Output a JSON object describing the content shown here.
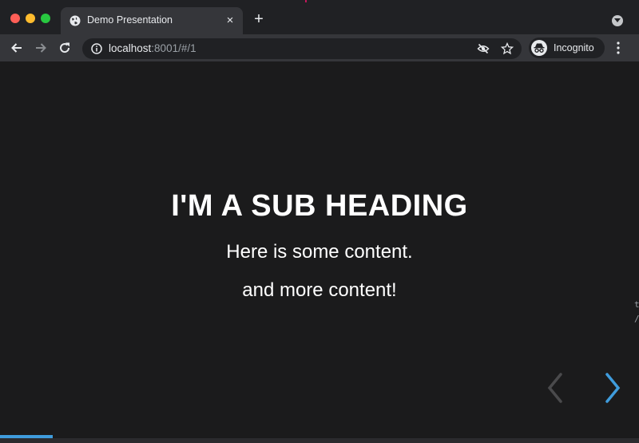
{
  "browser": {
    "tab": {
      "title": "Demo Presentation",
      "close_glyph": "×",
      "favicon": "globe-icon"
    },
    "new_tab_glyph": "+",
    "address_bar": {
      "host": "localhost",
      "rest": ":8001/#/1"
    },
    "profile": {
      "label": "Incognito",
      "icon": "incognito-icon"
    },
    "colors": {
      "tabstrip": "#202124",
      "toolbar": "#35363a",
      "omnibox": "#202124",
      "accent": "#3f9cdc"
    }
  },
  "slide": {
    "heading": "I'M A SUB HEADING",
    "paragraphs": [
      "Here is some content.",
      "and more content!"
    ],
    "progress": 0.083,
    "controls": {
      "prev_enabled": false,
      "next_enabled": true
    }
  },
  "edge_text": [
    "t",
    "/"
  ]
}
